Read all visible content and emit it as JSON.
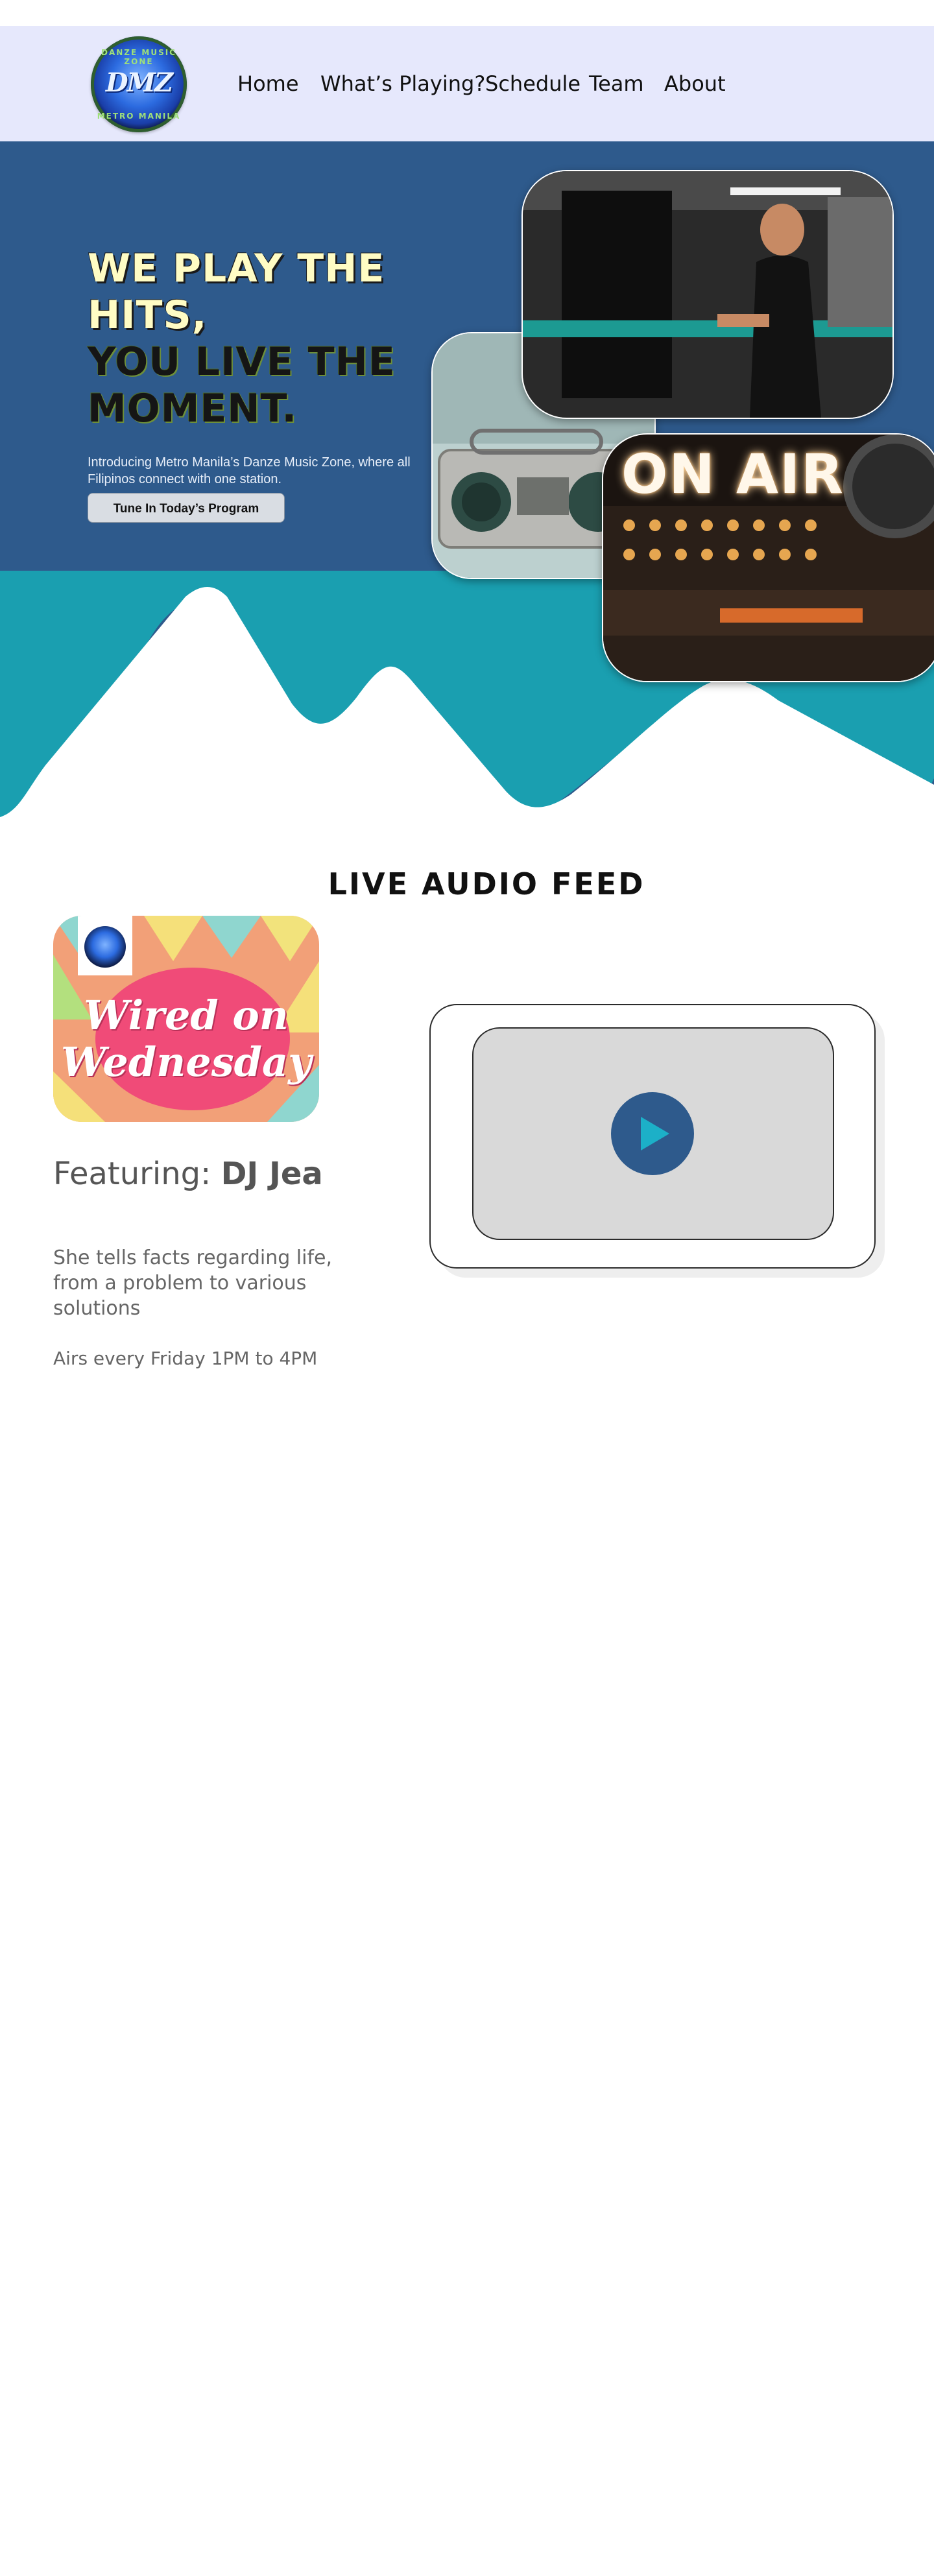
{
  "nav": {
    "logo": {
      "ring_top": "DANZE MUSIC ZONE",
      "mark": "DMZ",
      "ring_bottom": "METRO MANILA"
    },
    "links": [
      "Home",
      "What’s Playing?",
      "Schedule",
      "Team",
      "About"
    ]
  },
  "hero": {
    "heading_line1": "WE PLAY THE",
    "heading_line2": "HITS,",
    "heading_line3": "YOU LIVE THE",
    "heading_line4": "MOMENT.",
    "subtitle": "Introducing Metro Manila’s Danze Music Zone, where all Filipinos connect with one station.",
    "cta_label": "Tune In Today’s Program",
    "onair_sign": "ON AIR"
  },
  "live": {
    "section_title": "LIVE AUDIO FEED",
    "show_title_line1": "Wired on",
    "show_title_line2": "Wednesday",
    "featuring_label": "Featuring:",
    "host": "DJ Jea",
    "description": "She tells facts regarding life, from a problem to various solutions",
    "schedule": "Airs every Friday 1PM to 4PM"
  },
  "colors": {
    "nav_bg": "#e6e8fc",
    "hero_bg": "#2e5a8c",
    "wave_teal": "#1a9fb0",
    "heading_highlight": "#fffcc4",
    "player_button": "#2e5a8c",
    "play_triangle": "#1cb0c8"
  },
  "icons": {
    "player": "play-icon"
  }
}
